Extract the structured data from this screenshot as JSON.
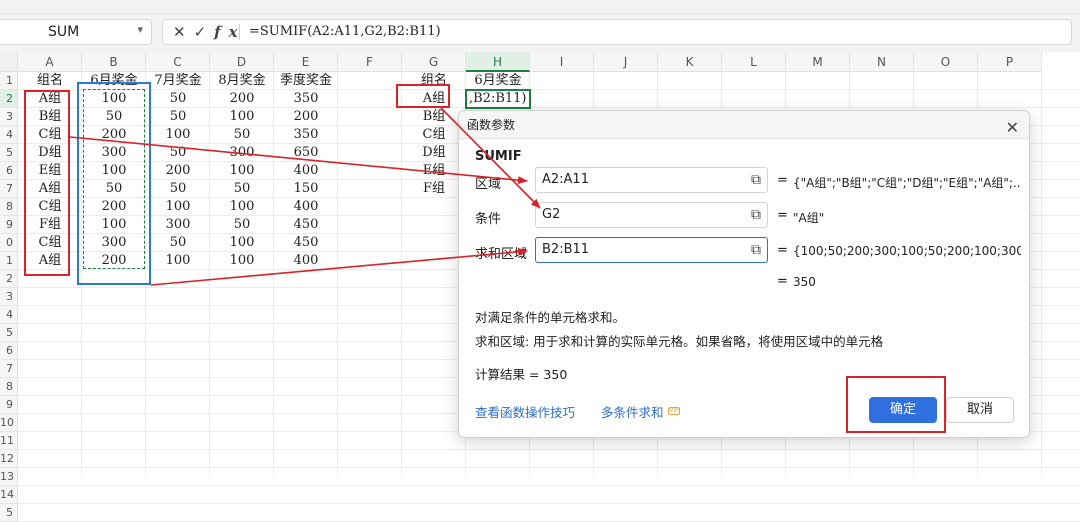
{
  "formula_bar": {
    "name_box": "SUM",
    "cancel_icon": "✕",
    "confirm_icon": "✓",
    "fx_label": "fx",
    "formula": "=SUMIF(A2:A11,G2,B2:B11)"
  },
  "columns": [
    "A",
    "B",
    "C",
    "D",
    "E",
    "F",
    "G",
    "H",
    "I",
    "J",
    "K",
    "L",
    "M",
    "N",
    "O",
    "P"
  ],
  "selected_column": "H",
  "row_labels": [
    "1",
    "2",
    "3",
    "4",
    "5",
    "6",
    "7",
    "8",
    "9",
    "0",
    "1",
    "2",
    "3",
    "4",
    "5",
    "6",
    "7",
    "8",
    "9",
    "10",
    "11",
    "12",
    "13",
    "14",
    "5"
  ],
  "table": {
    "headers": [
      "组名",
      "6月奖金",
      "7月奖金",
      "8月奖金",
      "季度奖金"
    ],
    "rows": [
      [
        "A组",
        "100",
        "50",
        "200",
        "350"
      ],
      [
        "B组",
        "50",
        "50",
        "100",
        "200"
      ],
      [
        "C组",
        "200",
        "100",
        "50",
        "350"
      ],
      [
        "D组",
        "300",
        "50",
        "300",
        "650"
      ],
      [
        "E组",
        "100",
        "200",
        "100",
        "400"
      ],
      [
        "A组",
        "50",
        "50",
        "50",
        "150"
      ],
      [
        "C组",
        "200",
        "100",
        "100",
        "400"
      ],
      [
        "F组",
        "100",
        "300",
        "50",
        "450"
      ],
      [
        "C组",
        "300",
        "50",
        "100",
        "450"
      ],
      [
        "A组",
        "200",
        "100",
        "100",
        "400"
      ]
    ]
  },
  "lookup": {
    "header_g": "组名",
    "header_h": "6月奖金",
    "groups": [
      "A组",
      "B组",
      "C组",
      "D组",
      "E组",
      "F组"
    ],
    "active_cell_text": ",B2:B11)"
  },
  "dialog": {
    "title": "函数参数",
    "close_icon": "✕",
    "function_name": "SUMIF",
    "args": [
      {
        "label": "区域",
        "value": "A2:A11",
        "result": "{\"A组\";\"B组\";\"C组\";\"D组\";\"E组\";\"A组\";..."
      },
      {
        "label": "条件",
        "value": "G2",
        "result": "\"A组\""
      },
      {
        "label": "求和区域",
        "value": "B2:B11",
        "result": "{100;50;200;300;100;50;200;100;300;..."
      }
    ],
    "equals": "=",
    "formula_result": "350",
    "description": "对满足条件的单元格求和。",
    "arg_help": "求和区域:  用于求和计算的实际单元格。如果省略，将使用区域中的单元格",
    "calc_label": "计算结果  =  350",
    "link_tips": "查看函数操作技巧",
    "link_multi": "多条件求和",
    "vip_badge": "VIP",
    "ok_label": "确定",
    "cancel_label": "取消"
  },
  "colors": {
    "annotation_red": "#d8232a",
    "annotation_blue": "#2b7bd6",
    "selection_green": "#1e7e45",
    "primary_button": "#2f6fde"
  }
}
